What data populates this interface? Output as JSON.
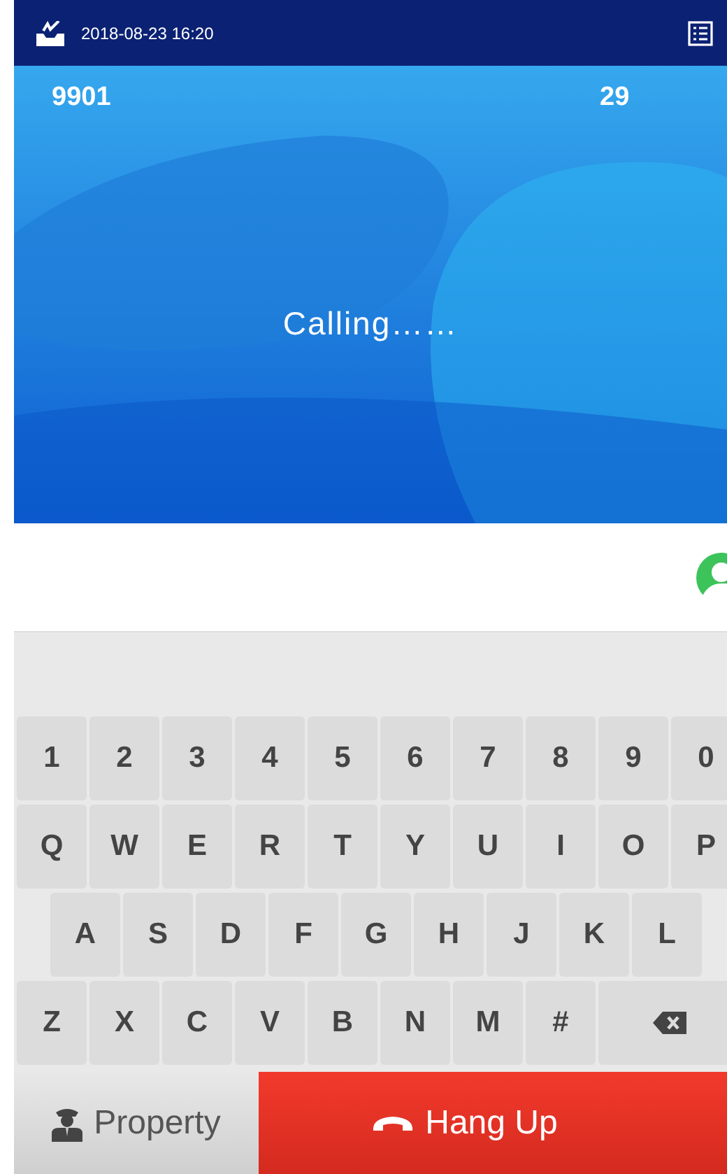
{
  "status_bar": {
    "datetime": "2018-08-23 16:20"
  },
  "call": {
    "number": "9901",
    "count": "29",
    "status": "Calling……"
  },
  "keyboard": {
    "rows": [
      [
        {
          "kind": "char",
          "label": "1"
        },
        {
          "kind": "char",
          "label": "2"
        },
        {
          "kind": "char",
          "label": "3"
        },
        {
          "kind": "char",
          "label": "4"
        },
        {
          "kind": "char",
          "label": "5"
        },
        {
          "kind": "char",
          "label": "6"
        },
        {
          "kind": "char",
          "label": "7"
        },
        {
          "kind": "char",
          "label": "8"
        },
        {
          "kind": "char",
          "label": "9"
        },
        {
          "kind": "char",
          "label": "0"
        }
      ],
      [
        {
          "kind": "char",
          "label": "Q"
        },
        {
          "kind": "char",
          "label": "W"
        },
        {
          "kind": "char",
          "label": "E"
        },
        {
          "kind": "char",
          "label": "R"
        },
        {
          "kind": "char",
          "label": "T"
        },
        {
          "kind": "char",
          "label": "Y"
        },
        {
          "kind": "char",
          "label": "U"
        },
        {
          "kind": "char",
          "label": "I"
        },
        {
          "kind": "char",
          "label": "O"
        },
        {
          "kind": "char",
          "label": "P"
        }
      ],
      [
        {
          "kind": "char",
          "label": "A"
        },
        {
          "kind": "char",
          "label": "S"
        },
        {
          "kind": "char",
          "label": "D"
        },
        {
          "kind": "char",
          "label": "F"
        },
        {
          "kind": "char",
          "label": "G"
        },
        {
          "kind": "char",
          "label": "H"
        },
        {
          "kind": "char",
          "label": "J"
        },
        {
          "kind": "char",
          "label": "K"
        },
        {
          "kind": "char",
          "label": "L"
        }
      ],
      [
        {
          "kind": "char",
          "label": "Z"
        },
        {
          "kind": "char",
          "label": "X"
        },
        {
          "kind": "char",
          "label": "C"
        },
        {
          "kind": "char",
          "label": "V"
        },
        {
          "kind": "char",
          "label": "B"
        },
        {
          "kind": "char",
          "label": "N"
        },
        {
          "kind": "char",
          "label": "M"
        },
        {
          "kind": "char",
          "label": "#"
        },
        {
          "kind": "backspace"
        }
      ]
    ]
  },
  "buttons": [
    {
      "kind": "property",
      "label": "Property"
    },
    {
      "kind": "hangup",
      "label": "Hang Up"
    }
  ]
}
